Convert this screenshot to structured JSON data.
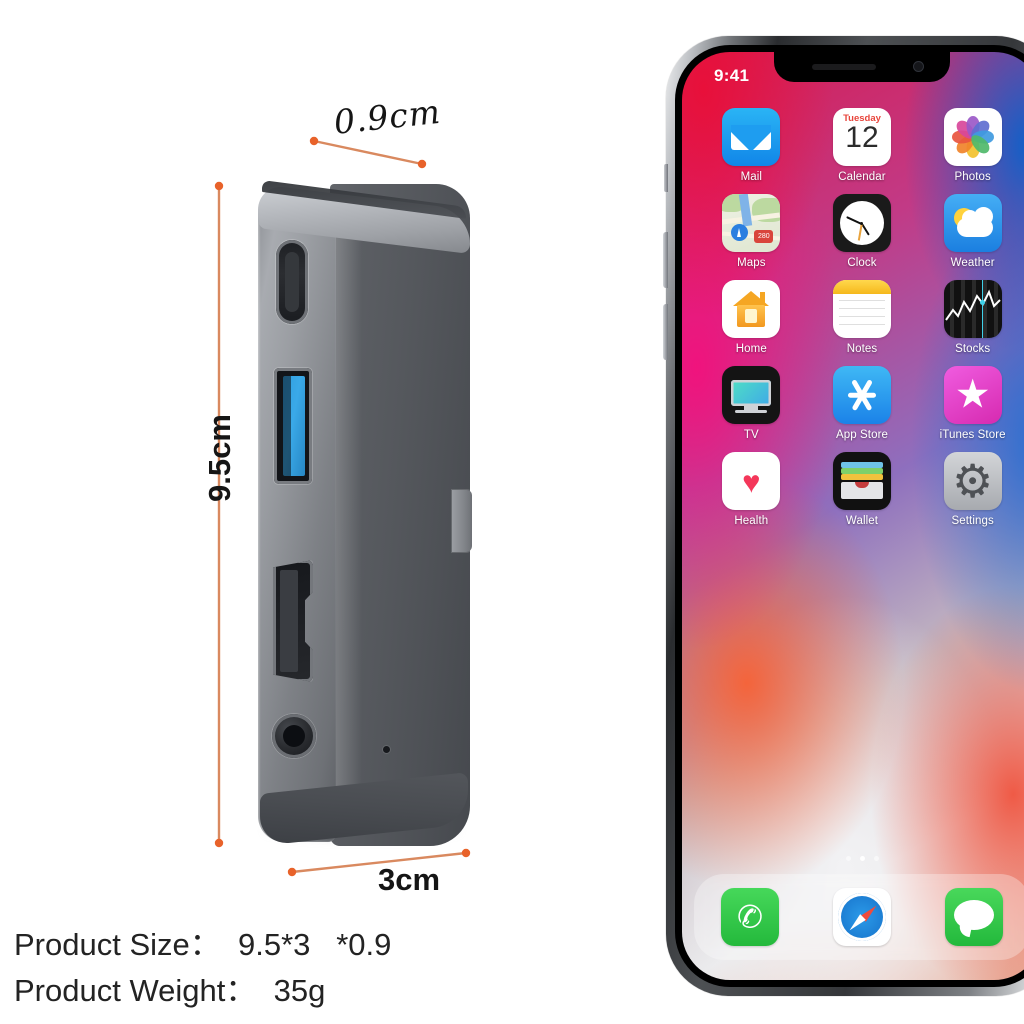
{
  "page": {
    "background_color": "#ffffff",
    "accent_color": "#d9895f"
  },
  "dimensions": {
    "depth_label": "0.9cm",
    "height_label": "9.5cm",
    "width_label": "3cm"
  },
  "product": {
    "type": "usb-c-hub",
    "body_color": "#55585d",
    "ports": [
      {
        "name": "usb-c-power-port",
        "label": "USB-C"
      },
      {
        "name": "usb-a-3-port",
        "label": "USB 3.0",
        "color": "#3aa9e8"
      },
      {
        "name": "hdmi-port",
        "label": "HDMI"
      },
      {
        "name": "audio-jack-port",
        "label": "3.5mm"
      }
    ],
    "led_label": "LED",
    "connector_label": "USB-C connector"
  },
  "phone": {
    "status_time": "9:41",
    "wallpaper_colors": [
      "#d51c52",
      "#c23a86",
      "#8e6fbe",
      "#eaeaec",
      "#e8a893"
    ],
    "apps": [
      {
        "label": "Mail",
        "icon": "mail-icon"
      },
      {
        "label": "Calendar",
        "icon": "calendar-icon",
        "day": "Tuesday",
        "date": "12"
      },
      {
        "label": "Photos",
        "icon": "photos-icon"
      },
      {
        "label": "Maps",
        "icon": "maps-icon",
        "badge": "280"
      },
      {
        "label": "Clock",
        "icon": "clock-icon"
      },
      {
        "label": "Weather",
        "icon": "weather-icon"
      },
      {
        "label": "Home",
        "icon": "home-icon"
      },
      {
        "label": "Notes",
        "icon": "notes-icon"
      },
      {
        "label": "Stocks",
        "icon": "stocks-icon"
      },
      {
        "label": "TV",
        "icon": "tv-icon"
      },
      {
        "label": "App Store",
        "icon": "app-store-icon"
      },
      {
        "label": "iTunes Store",
        "icon": "itunes-store-icon"
      },
      {
        "label": "Health",
        "icon": "health-icon"
      },
      {
        "label": "Wallet",
        "icon": "wallet-icon"
      },
      {
        "label": "Settings",
        "icon": "settings-icon"
      }
    ],
    "dock": [
      {
        "label": "Phone",
        "icon": "phone-icon"
      },
      {
        "label": "Safari",
        "icon": "safari-icon"
      },
      {
        "label": "Messages",
        "icon": "messages-icon"
      }
    ],
    "page_dots": {
      "count": 3,
      "active_index": 1
    }
  },
  "specs": {
    "size_line": "Product Size：  9.5*3   *0.9",
    "weight_line": "Product Weight：  35g"
  }
}
